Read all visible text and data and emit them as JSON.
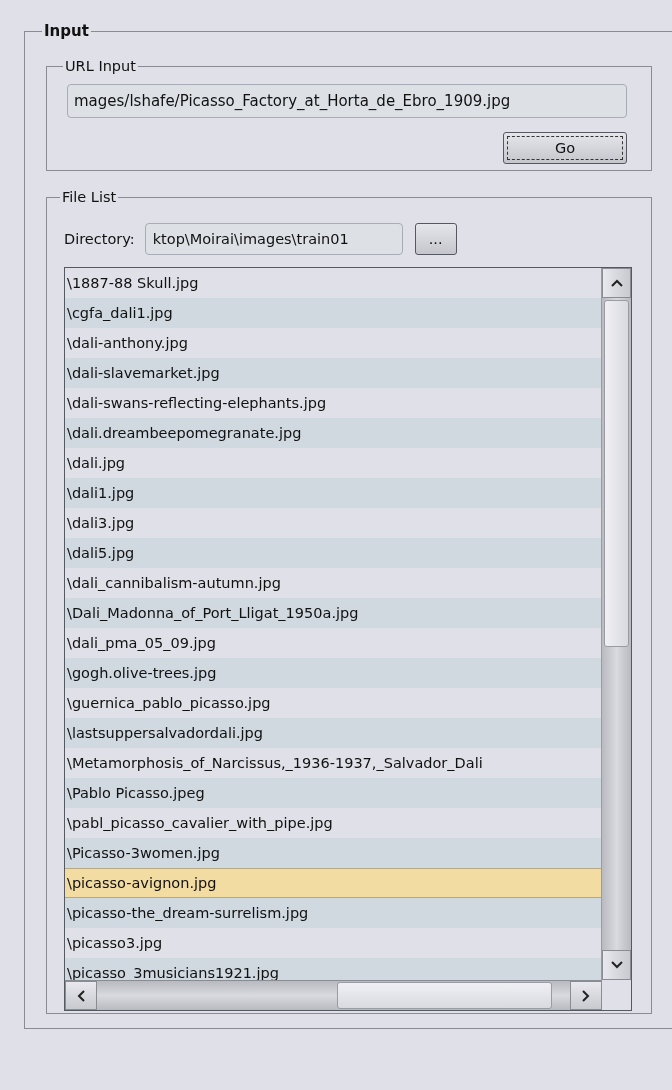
{
  "input_group": {
    "title": "Input",
    "url_input": {
      "title": "URL Input",
      "value": "mages/lshafe/Picasso_Factory_at_Horta_de_Ebro_1909.jpg",
      "go_button": "Go"
    },
    "file_list": {
      "title": "File List",
      "directory_label": "Directory:",
      "directory_value": "ktop\\Moirai\\images\\train01",
      "browse_button": "...",
      "files": [
        {
          "name": "\\1887-88 Skull.jpg",
          "selected": false
        },
        {
          "name": "\\cgfa_dali1.jpg",
          "selected": false
        },
        {
          "name": "\\dali-anthony.jpg",
          "selected": false
        },
        {
          "name": "\\dali-slavemarket.jpg",
          "selected": false
        },
        {
          "name": "\\dali-swans-reflecting-elephants.jpg",
          "selected": false
        },
        {
          "name": "\\dali.dreambeepomegranate.jpg",
          "selected": false
        },
        {
          "name": "\\dali.jpg",
          "selected": false
        },
        {
          "name": "\\dali1.jpg",
          "selected": false
        },
        {
          "name": "\\dali3.jpg",
          "selected": false
        },
        {
          "name": "\\dali5.jpg",
          "selected": false
        },
        {
          "name": "\\dali_cannibalism-autumn.jpg",
          "selected": false
        },
        {
          "name": "\\Dali_Madonna_of_Port_Lligat_1950a.jpg",
          "selected": false
        },
        {
          "name": "\\dali_pma_05_09.jpg",
          "selected": false
        },
        {
          "name": "\\gogh.olive-trees.jpg",
          "selected": false
        },
        {
          "name": "\\guernica_pablo_picasso.jpg",
          "selected": false
        },
        {
          "name": "\\lastsuppersalvadordali.jpg",
          "selected": false
        },
        {
          "name": "\\Metamorphosis_of_Narcissus,_1936-1937,_Salvador_Dali",
          "selected": false
        },
        {
          "name": "\\Pablo Picasso.jpeg",
          "selected": false
        },
        {
          "name": "\\pabl_picasso_cavalier_with_pipe.jpg",
          "selected": false
        },
        {
          "name": "\\Picasso-3women.jpg",
          "selected": false
        },
        {
          "name": "\\picasso-avignon.jpg",
          "selected": true
        },
        {
          "name": "\\picasso-the_dream-surrelism.jpg",
          "selected": false
        },
        {
          "name": "\\picasso3.jpg",
          "selected": false
        },
        {
          "name": "\\picasso_3musicians1921.jpg",
          "selected": false
        }
      ]
    }
  }
}
